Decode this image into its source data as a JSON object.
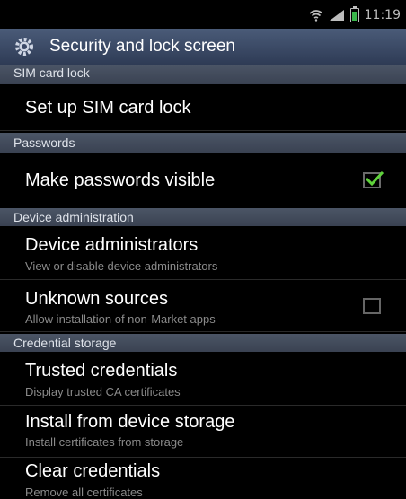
{
  "status_bar": {
    "time": "11:19",
    "icons": [
      "wifi-icon",
      "signal-icon",
      "battery-icon"
    ],
    "battery_level_fraction": 0.7
  },
  "header": {
    "title": "Security and lock screen",
    "icon": "gear-icon"
  },
  "sections": {
    "sim": {
      "header": "SIM card lock"
    },
    "passwords": {
      "header": "Passwords"
    },
    "device_admin": {
      "header": "Device administration"
    },
    "credentials": {
      "header": "Credential storage"
    }
  },
  "items": {
    "setup_sim_lock": {
      "label": "Set up SIM card lock"
    },
    "make_passwords_visible": {
      "label": "Make passwords visible",
      "checked": true
    },
    "device_administrators": {
      "label": "Device administrators",
      "sub": "View or disable device administrators"
    },
    "unknown_sources": {
      "label": "Unknown sources",
      "sub": "Allow installation of non-Market apps",
      "checked": false
    },
    "trusted_credentials": {
      "label": "Trusted credentials",
      "sub": "Display trusted CA certificates"
    },
    "install_from_storage": {
      "label": "Install from device storage",
      "sub": "Install certificates from storage"
    },
    "clear_credentials": {
      "label": "Clear credentials",
      "sub": "Remove all certificates"
    }
  },
  "colors": {
    "checkmark": "#5fd23b",
    "section_header_bg": "#3f4757",
    "title_bar_bg": "#3a4866"
  }
}
